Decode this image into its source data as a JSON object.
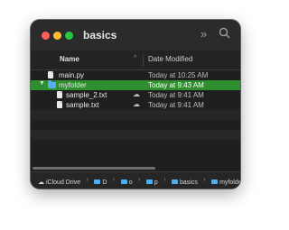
{
  "window": {
    "title": "basics"
  },
  "columns": {
    "name": "Name",
    "date_modified": "Date Modified"
  },
  "rows": [
    {
      "name": "main.py",
      "date": "Today at 10:25 AM",
      "kind": "file",
      "indent": 0,
      "selected": false
    },
    {
      "name": "myfolder",
      "date": "Today at 9:43 AM",
      "kind": "folder",
      "indent": 0,
      "selected": true,
      "expanded": true
    },
    {
      "name": "sample_2.txt",
      "date": "Today at 9:41 AM",
      "kind": "file",
      "indent": 1,
      "selected": false,
      "icloud": true
    },
    {
      "name": "sample.txt",
      "date": "Today at 9:41 AM",
      "kind": "file",
      "indent": 1,
      "selected": false,
      "icloud": true
    }
  ],
  "pathbar": {
    "root": "iCloud Drive",
    "segments": [
      "D",
      "o",
      "p",
      "basics",
      "myfolder"
    ]
  },
  "colors": {
    "selection": "#2f8f2f",
    "folder": "#52aef0",
    "window_bg": "#1f1f1f"
  },
  "icons": {
    "close": "traffic-close",
    "minimize": "traffic-minimize",
    "zoom": "traffic-zoom",
    "more": "chevron-double-right-icon",
    "search": "search-icon"
  }
}
